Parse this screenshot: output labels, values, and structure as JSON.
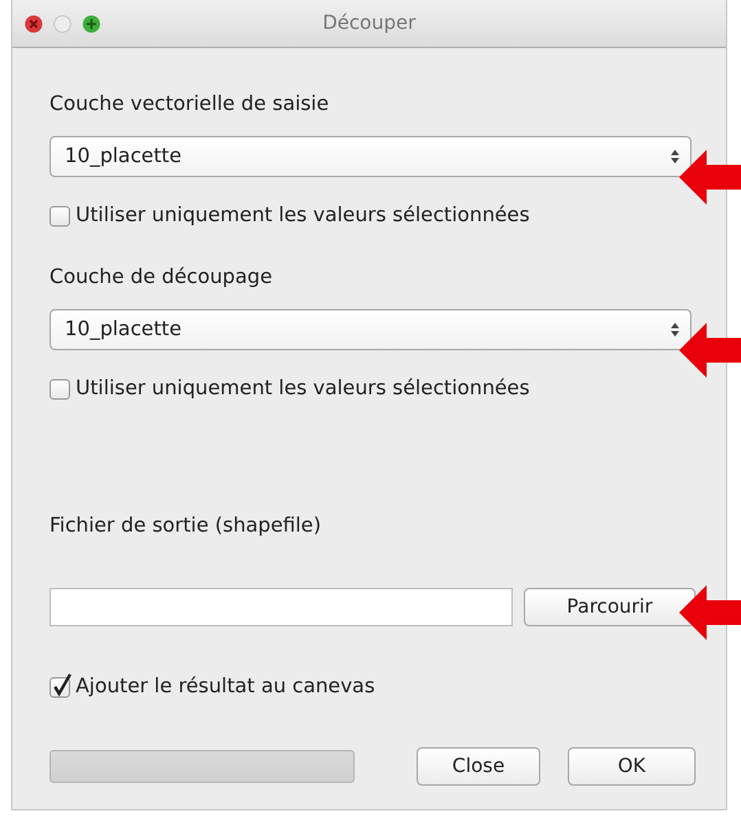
{
  "window": {
    "title": "Découper"
  },
  "input_layer": {
    "label": "Couche vectorielle de saisie",
    "value": "10_placette",
    "highlighted": true
  },
  "input_selected_only": {
    "label": "Utiliser uniquement les valeurs sélectionnées",
    "checked": false
  },
  "clip_layer": {
    "label": "Couche de découpage",
    "value": "10_placette",
    "highlighted": true
  },
  "clip_selected_only": {
    "label": "Utiliser uniquement les valeurs sélectionnées",
    "checked": false
  },
  "output": {
    "label": "Fichier de sortie (shapefile)",
    "browse_button": "Parcourir",
    "highlighted": true
  },
  "add_to_canvas": {
    "label": "Ajouter le résultat au canevas",
    "checked": true
  },
  "progress": {
    "level": 0
  },
  "buttons": [
    "Close",
    "OK"
  ]
}
